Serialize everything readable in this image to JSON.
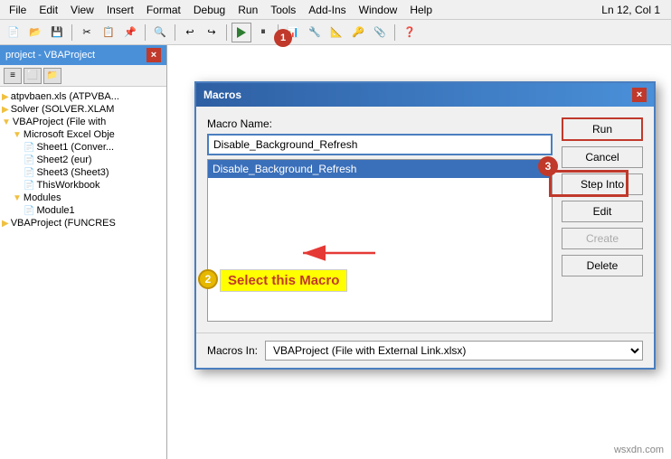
{
  "app": {
    "title": "project - VBAProject",
    "close_label": "×"
  },
  "menu": {
    "items": [
      "File",
      "Edit",
      "View",
      "Insert",
      "Format",
      "Debug",
      "Run",
      "Tools",
      "Add-Ins",
      "Window",
      "Help"
    ]
  },
  "toolbar": {
    "ln_col": "Ln 12, Col 1"
  },
  "project_panel": {
    "title": "project - VBAProject",
    "tree": [
      {
        "label": "atpvbaen.xls (ATPVBA...",
        "indent": 0,
        "icon": "📁"
      },
      {
        "label": "Solver (SOLVER.XLAM",
        "indent": 0,
        "icon": "📁"
      },
      {
        "label": "VBAProject (File with",
        "indent": 0,
        "icon": "📁"
      },
      {
        "label": "Microsoft Excel Obje",
        "indent": 1,
        "icon": "📁"
      },
      {
        "label": "Sheet1 (Conver...",
        "indent": 2,
        "icon": "📄"
      },
      {
        "label": "Sheet2 (eur)",
        "indent": 2,
        "icon": "📄"
      },
      {
        "label": "Sheet3 (Sheet3)",
        "indent": 2,
        "icon": "📄"
      },
      {
        "label": "ThisWorkbook",
        "indent": 2,
        "icon": "📄"
      },
      {
        "label": "Modules",
        "indent": 1,
        "icon": "📁"
      },
      {
        "label": "Module1",
        "indent": 2,
        "icon": "📄"
      },
      {
        "label": "VBAProject (FUNCRES",
        "indent": 0,
        "icon": "📁"
      }
    ]
  },
  "dialog": {
    "title": "Macros",
    "macro_name_label": "Macro Name:",
    "macro_name_value": "Disable_Background_Refresh",
    "macros_list": [
      "Disable_Background_Refresh"
    ],
    "selected_macro": "Disable_Background_Refresh",
    "buttons": {
      "run": "Run",
      "cancel": "Cancel",
      "step_into": "Step Into",
      "edit": "Edit",
      "create": "Create",
      "delete": "Delete"
    },
    "macros_in_label": "Macros In:",
    "macros_in_value": "VBAProject (File with External Link.xlsx)"
  },
  "annotation": {
    "badge1": "1",
    "badge2": "2",
    "badge3": "3",
    "select_macro_text": "Select this Macro"
  },
  "watermark": "wsxdn.com"
}
